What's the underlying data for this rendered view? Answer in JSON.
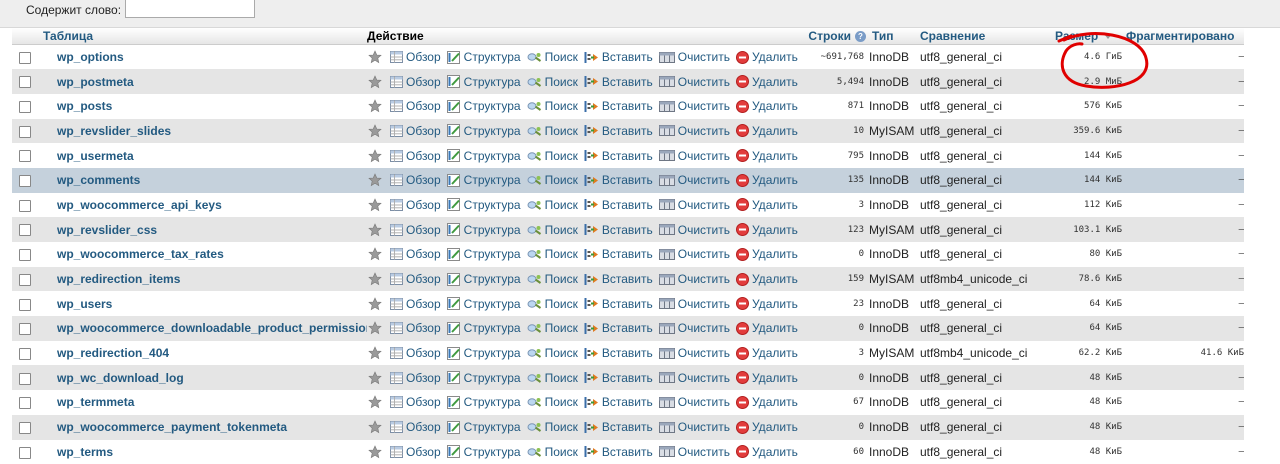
{
  "filter": {
    "label": "Содержит слово:",
    "value": ""
  },
  "header": {
    "table": "Таблица",
    "action": "Действие",
    "rows": "Строки",
    "type": "Тип",
    "collation": "Сравнение",
    "size": "Размер",
    "fragmented": "Фрагментировано"
  },
  "actions": {
    "browse": "Обзор",
    "structure": "Структура",
    "search": "Поиск",
    "insert": "Вставить",
    "empty": "Очистить",
    "drop": "Удалить"
  },
  "colors": {
    "link": "#235a81",
    "row_even": "#e5e5e5",
    "row_highlight": "#c5d1dc",
    "annotation": "#e00000"
  },
  "tables": [
    {
      "name": "wp_options",
      "rows": "~691,768",
      "type": "InnoDB",
      "collation": "utf8_general_ci",
      "size": "4.6",
      "unit": "ГиБ",
      "frag": "–"
    },
    {
      "name": "wp_postmeta",
      "rows": "5,494",
      "type": "InnoDB",
      "collation": "utf8_general_ci",
      "size": "2.9",
      "unit": "МиБ",
      "frag": "–"
    },
    {
      "name": "wp_posts",
      "rows": "871",
      "type": "InnoDB",
      "collation": "utf8_general_ci",
      "size": "576",
      "unit": "КиБ",
      "frag": "–"
    },
    {
      "name": "wp_revslider_slides",
      "rows": "10",
      "type": "MyISAM",
      "collation": "utf8_general_ci",
      "size": "359.6",
      "unit": "КиБ",
      "frag": "–"
    },
    {
      "name": "wp_usermeta",
      "rows": "795",
      "type": "InnoDB",
      "collation": "utf8_general_ci",
      "size": "144",
      "unit": "КиБ",
      "frag": "–"
    },
    {
      "name": "wp_comments",
      "rows": "135",
      "type": "InnoDB",
      "collation": "utf8_general_ci",
      "size": "144",
      "unit": "КиБ",
      "frag": "–"
    },
    {
      "name": "wp_woocommerce_api_keys",
      "rows": "3",
      "type": "InnoDB",
      "collation": "utf8_general_ci",
      "size": "112",
      "unit": "КиБ",
      "frag": "–"
    },
    {
      "name": "wp_revslider_css",
      "rows": "123",
      "type": "MyISAM",
      "collation": "utf8_general_ci",
      "size": "103.1",
      "unit": "КиБ",
      "frag": "–"
    },
    {
      "name": "wp_woocommerce_tax_rates",
      "rows": "0",
      "type": "InnoDB",
      "collation": "utf8_general_ci",
      "size": "80",
      "unit": "КиБ",
      "frag": "–"
    },
    {
      "name": "wp_redirection_items",
      "rows": "159",
      "type": "MyISAM",
      "collation": "utf8mb4_unicode_ci",
      "size": "78.6",
      "unit": "КиБ",
      "frag": "–"
    },
    {
      "name": "wp_users",
      "rows": "23",
      "type": "InnoDB",
      "collation": "utf8_general_ci",
      "size": "64",
      "unit": "КиБ",
      "frag": "–"
    },
    {
      "name": "wp_woocommerce_downloadable_product_permissions",
      "rows": "0",
      "type": "InnoDB",
      "collation": "utf8_general_ci",
      "size": "64",
      "unit": "КиБ",
      "frag": "–"
    },
    {
      "name": "wp_redirection_404",
      "rows": "3",
      "type": "MyISAM",
      "collation": "utf8mb4_unicode_ci",
      "size": "62.2",
      "unit": "КиБ",
      "frag": "41.6 КиБ"
    },
    {
      "name": "wp_wc_download_log",
      "rows": "0",
      "type": "InnoDB",
      "collation": "utf8_general_ci",
      "size": "48",
      "unit": "КиБ",
      "frag": "–"
    },
    {
      "name": "wp_termmeta",
      "rows": "67",
      "type": "InnoDB",
      "collation": "utf8_general_ci",
      "size": "48",
      "unit": "КиБ",
      "frag": "–"
    },
    {
      "name": "wp_woocommerce_payment_tokenmeta",
      "rows": "0",
      "type": "InnoDB",
      "collation": "utf8_general_ci",
      "size": "48",
      "unit": "КиБ",
      "frag": "–"
    },
    {
      "name": "wp_terms",
      "rows": "60",
      "type": "InnoDB",
      "collation": "utf8_general_ci",
      "size": "48",
      "unit": "КиБ",
      "frag": "–"
    }
  ]
}
